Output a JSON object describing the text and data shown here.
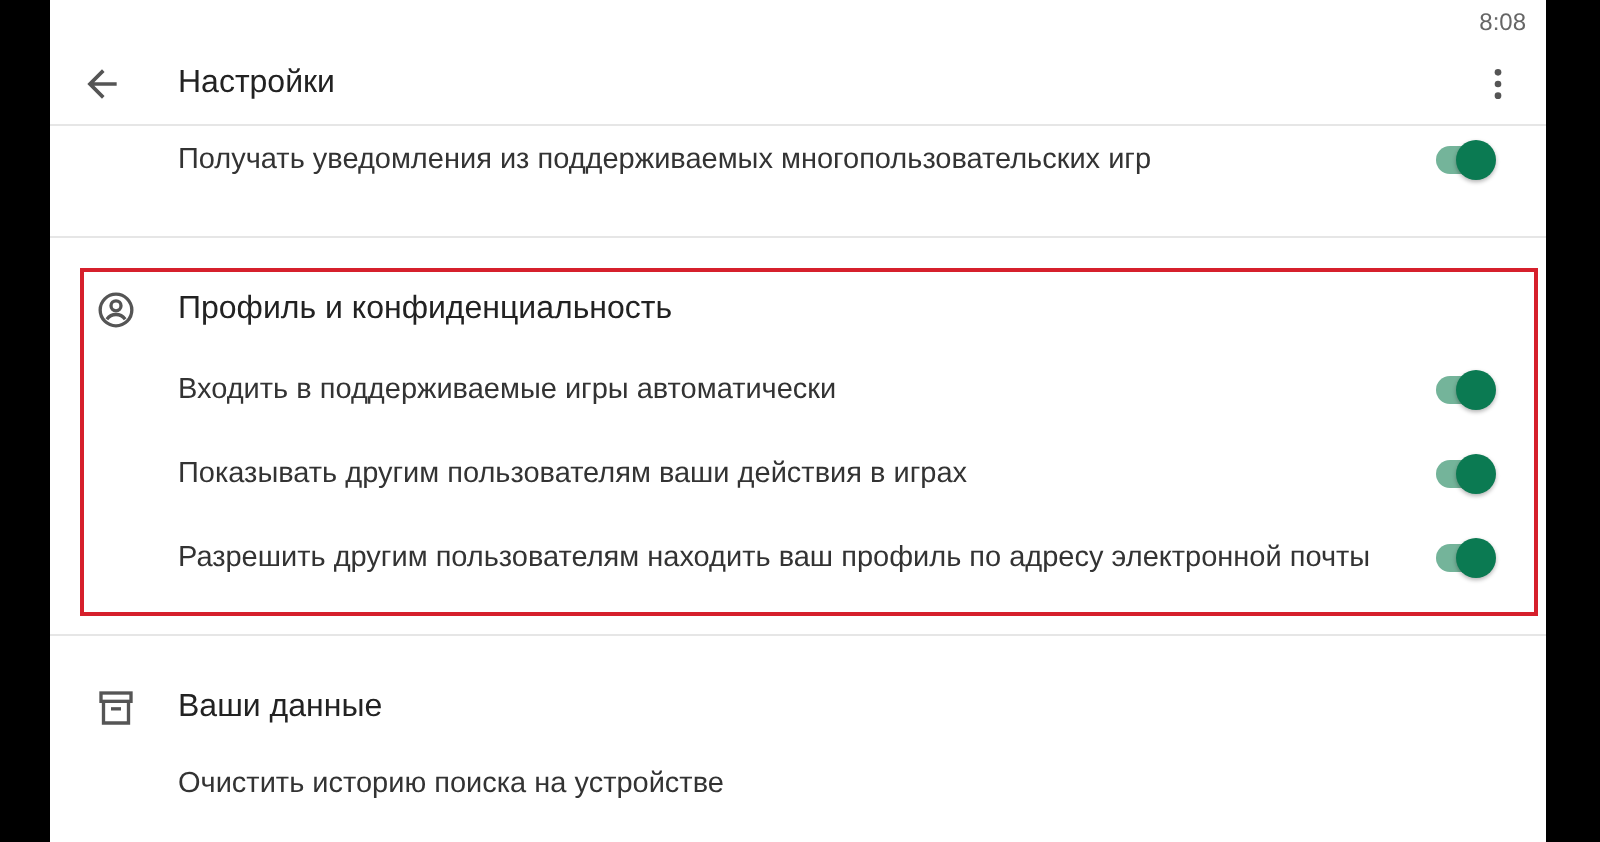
{
  "status_bar": {
    "time": "8:08"
  },
  "app_bar": {
    "title": "Настройки"
  },
  "sections": [
    {
      "items": [
        {
          "label": "Получать уведомления из поддерживаемых многопользовательских игр",
          "on": true
        }
      ]
    },
    {
      "title": "Профиль и конфиденциальность",
      "kind": "person",
      "highlighted": true,
      "items": [
        {
          "label": "Входить в поддерживаемые игры автоматически",
          "on": true
        },
        {
          "label": "Показывать другим пользователям ваши действия в играх",
          "on": true
        },
        {
          "label": "Разрешить другим пользователям находить ваш профиль по адресу электронной почты",
          "on": true
        }
      ]
    },
    {
      "title": "Ваши данные",
      "kind": "archive",
      "items": [
        {
          "label": "Очистить историю поиска на устройстве"
        }
      ]
    }
  ]
}
